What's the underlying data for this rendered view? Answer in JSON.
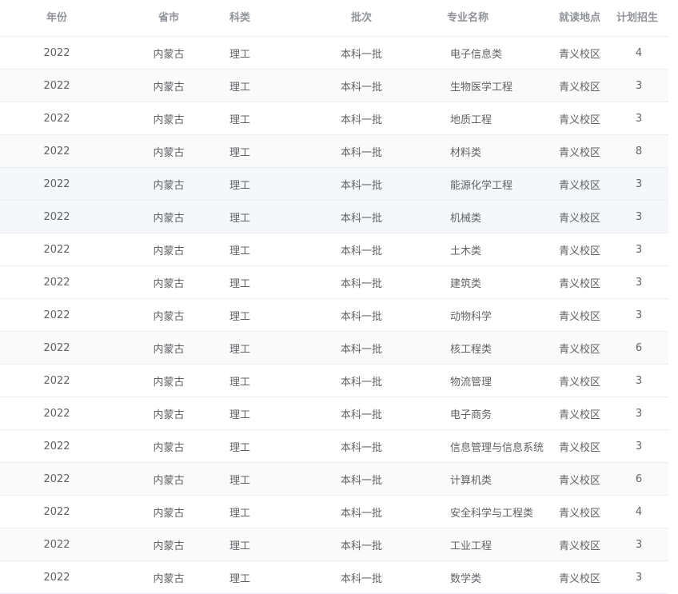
{
  "headers": {
    "year": "年份",
    "province": "省市",
    "type": "科类",
    "batch": "批次",
    "major": "专业名称",
    "location": "就读地点",
    "plan": "计划招生"
  },
  "rows": [
    {
      "year": "2022",
      "province": "内蒙古",
      "type": "理工",
      "batch": "本科一批",
      "major": "电子信息类",
      "location": "青义校区",
      "plan": "4"
    },
    {
      "year": "2022",
      "province": "内蒙古",
      "type": "理工",
      "batch": "本科一批",
      "major": "生物医学工程",
      "location": "青义校区",
      "plan": "3"
    },
    {
      "year": "2022",
      "province": "内蒙古",
      "type": "理工",
      "batch": "本科一批",
      "major": "地质工程",
      "location": "青义校区",
      "plan": "3"
    },
    {
      "year": "2022",
      "province": "内蒙古",
      "type": "理工",
      "batch": "本科一批",
      "major": "材料类",
      "location": "青义校区",
      "plan": "8"
    },
    {
      "year": "2022",
      "province": "内蒙古",
      "type": "理工",
      "batch": "本科一批",
      "major": "能源化学工程",
      "location": "青义校区",
      "plan": "3"
    },
    {
      "year": "2022",
      "province": "内蒙古",
      "type": "理工",
      "batch": "本科一批",
      "major": "机械类",
      "location": "青义校区",
      "plan": "3"
    },
    {
      "year": "2022",
      "province": "内蒙古",
      "type": "理工",
      "batch": "本科一批",
      "major": "土木类",
      "location": "青义校区",
      "plan": "3"
    },
    {
      "year": "2022",
      "province": "内蒙古",
      "type": "理工",
      "batch": "本科一批",
      "major": "建筑类",
      "location": "青义校区",
      "plan": "3"
    },
    {
      "year": "2022",
      "province": "内蒙古",
      "type": "理工",
      "batch": "本科一批",
      "major": "动物科学",
      "location": "青义校区",
      "plan": "3"
    },
    {
      "year": "2022",
      "province": "内蒙古",
      "type": "理工",
      "batch": "本科一批",
      "major": "核工程类",
      "location": "青义校区",
      "plan": "6"
    },
    {
      "year": "2022",
      "province": "内蒙古",
      "type": "理工",
      "batch": "本科一批",
      "major": "物流管理",
      "location": "青义校区",
      "plan": "3"
    },
    {
      "year": "2022",
      "province": "内蒙古",
      "type": "理工",
      "batch": "本科一批",
      "major": "电子商务",
      "location": "青义校区",
      "plan": "3"
    },
    {
      "year": "2022",
      "province": "内蒙古",
      "type": "理工",
      "batch": "本科一批",
      "major": "信息管理与信息系统",
      "location": "青义校区",
      "plan": "3"
    },
    {
      "year": "2022",
      "province": "内蒙古",
      "type": "理工",
      "batch": "本科一批",
      "major": "计算机类",
      "location": "青义校区",
      "plan": "6"
    },
    {
      "year": "2022",
      "province": "内蒙古",
      "type": "理工",
      "batch": "本科一批",
      "major": "安全科学与工程类",
      "location": "青义校区",
      "plan": "4"
    },
    {
      "year": "2022",
      "province": "内蒙古",
      "type": "理工",
      "batch": "本科一批",
      "major": "工业工程",
      "location": "青义校区",
      "plan": "3"
    },
    {
      "year": "2022",
      "province": "内蒙古",
      "type": "理工",
      "batch": "本科一批",
      "major": "数学类",
      "location": "青义校区",
      "plan": "3"
    }
  ]
}
